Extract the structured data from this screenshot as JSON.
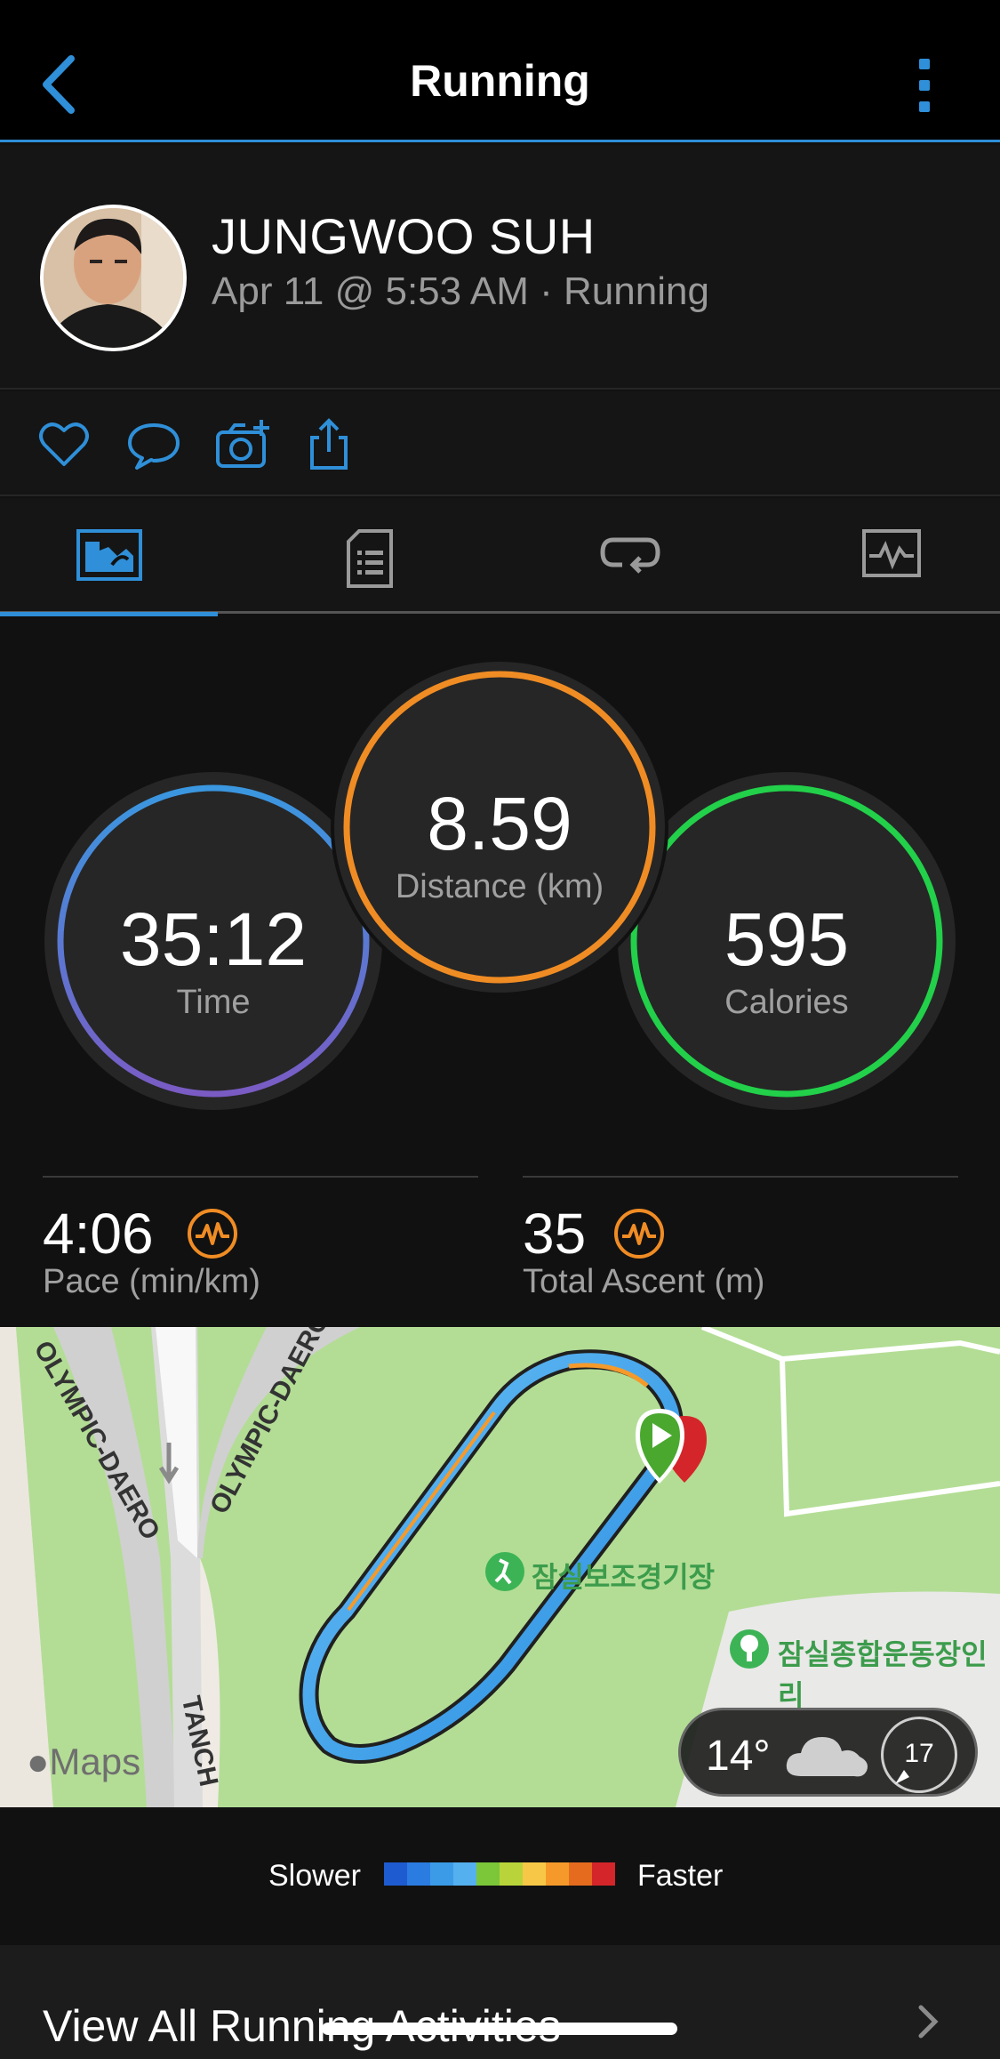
{
  "header": {
    "title": "Running",
    "back_icon": "chevron-left-icon",
    "menu_icon": "more-vertical-icon",
    "accent": "#2f8fd8"
  },
  "profile": {
    "name": "JUNGWOO SUH",
    "meta": "Apr 11 @ 5:53 AM · Running"
  },
  "actions": [
    {
      "icon": "heart-icon"
    },
    {
      "icon": "comment-icon"
    },
    {
      "icon": "camera-add-icon"
    },
    {
      "icon": "share-icon"
    }
  ],
  "tabs": [
    {
      "icon": "overview-map-icon",
      "active": true
    },
    {
      "icon": "details-list-icon",
      "active": false
    },
    {
      "icon": "laps-icon",
      "active": false
    },
    {
      "icon": "charts-icon",
      "active": false
    }
  ],
  "stats": {
    "time": {
      "value": "35:12",
      "label": "Time"
    },
    "distance": {
      "value": "8.59",
      "label": "Distance (km)"
    },
    "calories": {
      "value": "595",
      "label": "Calories"
    },
    "pace": {
      "value": "4:06",
      "label": "Pace (min/km)"
    },
    "ascent": {
      "value": "35",
      "label": "Total Ascent (m)"
    }
  },
  "map": {
    "roads": [
      "OLYMPIC-DAERO",
      "OLYMPIC-DAERO",
      "TANCH"
    ],
    "places": [
      "잠실보조경기장",
      "잠실종합운동장인리"
    ],
    "brand": "Maps",
    "weather": {
      "temp": "14°",
      "wind": "17"
    }
  },
  "legend": {
    "slower": "Slower",
    "faster": "Faster",
    "colors": [
      "#1f5bd0",
      "#2b7ce0",
      "#3b9be6",
      "#55b0ef",
      "#7cc63a",
      "#b9d43a",
      "#f7c847",
      "#f59a2a",
      "#e56b1f",
      "#d4262a"
    ]
  },
  "footer": {
    "label": "View All Running Activities"
  }
}
